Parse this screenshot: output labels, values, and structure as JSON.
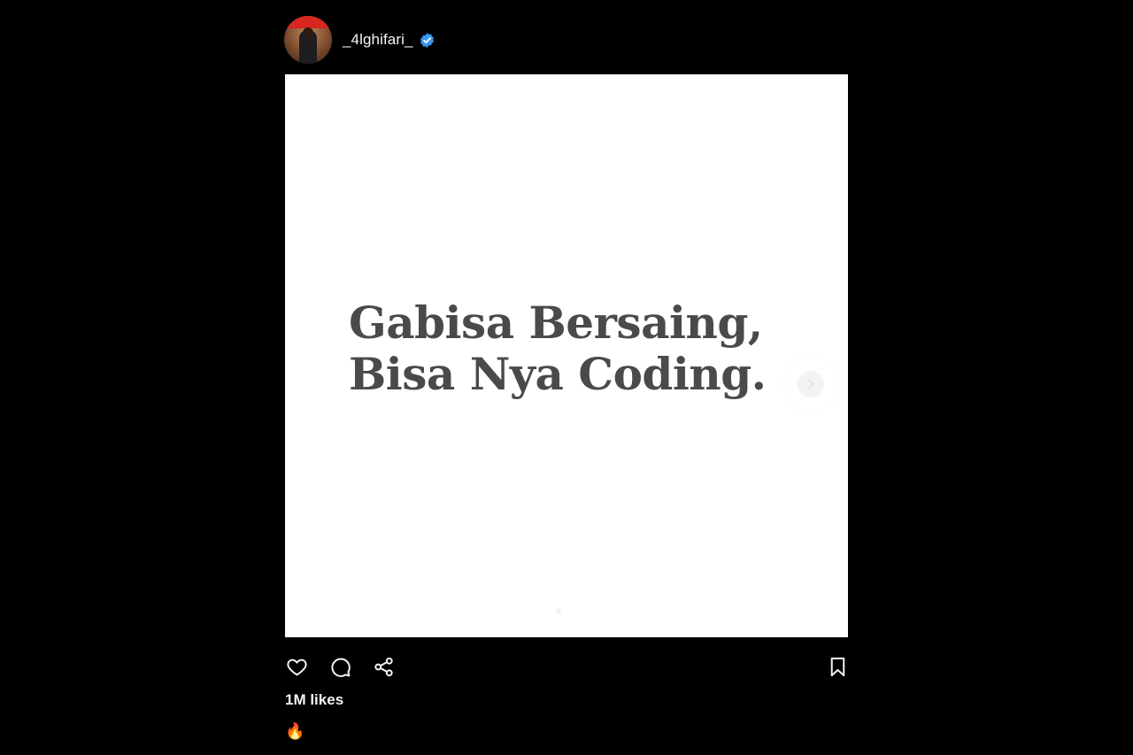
{
  "post": {
    "username": "_4lghifari_",
    "verified": true,
    "media_text": {
      "line1": "Gabisa Bersaing,",
      "line2": "Bisa Nya Coding."
    },
    "likes_label": "1M likes",
    "caption": "🔥"
  },
  "icons": {
    "verified": "verified-badge-icon",
    "like": "heart-icon",
    "comment": "comment-icon",
    "share": "share-icon",
    "save": "bookmark-icon",
    "next": "chevron-right-icon"
  },
  "colors": {
    "background": "#000000",
    "media_background": "#ffffff",
    "media_text": "#4a4a4a",
    "verified_blue": "#3897f0",
    "text": "#f5f5f5"
  }
}
